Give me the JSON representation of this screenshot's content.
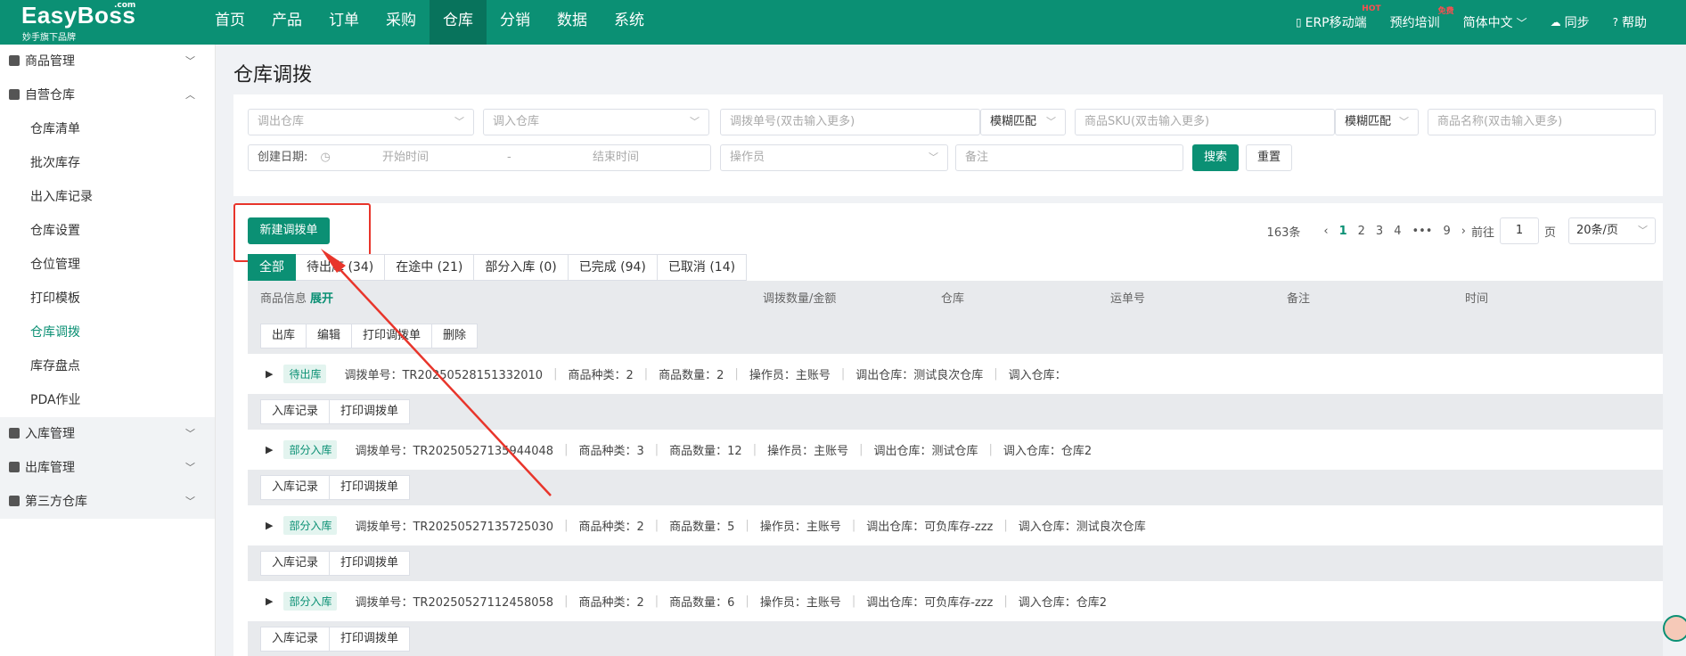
{
  "logo": {
    "brand": "EasyBoss",
    "com": ".com",
    "sub": "妙手旗下品牌"
  },
  "nav": [
    {
      "label": "首页"
    },
    {
      "label": "产品"
    },
    {
      "label": "订单"
    },
    {
      "label": "采购"
    },
    {
      "label": "仓库"
    },
    {
      "label": "分销"
    },
    {
      "label": "数据"
    },
    {
      "label": "系统"
    }
  ],
  "nav_active": "仓库",
  "right_nav": {
    "erp": "ERP移动端",
    "erp_sup": "HOT",
    "training": "预约培训",
    "training_sup": "免费",
    "lang": "简体中文",
    "sync": "同步",
    "help": "帮助"
  },
  "sidebar": {
    "groups": [
      {
        "label": "商品管理"
      },
      {
        "label": "自营仓库"
      },
      {
        "label": "入库管理"
      },
      {
        "label": "出库管理"
      },
      {
        "label": "第三方仓库"
      }
    ],
    "items": [
      {
        "label": "仓库清单"
      },
      {
        "label": "批次库存"
      },
      {
        "label": "出入库记录"
      },
      {
        "label": "仓库设置"
      },
      {
        "label": "仓位管理"
      },
      {
        "label": "打印模板"
      },
      {
        "label": "仓库调拨"
      },
      {
        "label": "库存盘点"
      },
      {
        "label": "PDA作业"
      }
    ]
  },
  "page": {
    "title": "仓库调拨"
  },
  "filters": {
    "out_wh": "调出仓库",
    "in_wh": "调入仓库",
    "order_no": "调拨单号(双击输入更多)",
    "match1": "模糊匹配",
    "sku": "商品SKU(双击输入更多)",
    "match2": "模糊匹配",
    "name": "商品名称(双击输入更多)",
    "date_label": "创建日期:",
    "start": "开始时间",
    "dash": "-",
    "end": "结束时间",
    "operator": "操作员",
    "remark": "备注",
    "search": "搜索",
    "reset": "重置"
  },
  "list": {
    "new_button": "新建调拨单",
    "pager": {
      "total": "163条",
      "prev": "‹",
      "pages": [
        "1",
        "2",
        "3",
        "4",
        "•••",
        "9"
      ],
      "current": "1",
      "next": "›",
      "goto": "前往",
      "goto_value": "1",
      "page_unit": "页",
      "page_size": "20条/页"
    },
    "tabs": [
      {
        "label": "全部"
      },
      {
        "label": "待出库 (34)"
      },
      {
        "label": "在途中 (21)"
      },
      {
        "label": "部分入库 (0)"
      },
      {
        "label": "已完成 (94)"
      },
      {
        "label": "已取消 (14)"
      }
    ],
    "columns": {
      "product": "商品信息",
      "expand": "展开",
      "qty": "调拨数量/金额",
      "warehouse": "仓库",
      "tracking": "运单号",
      "remark": "备注",
      "time": "时间"
    },
    "first_actions": [
      "出库",
      "编辑",
      "打印调拨单",
      "删除"
    ],
    "record_actions": [
      "入库记录",
      "打印调拨单"
    ],
    "rows": [
      {
        "status": "待出库",
        "no": "调拨单号：TR20250528151332010",
        "kinds": "商品种类：2",
        "qty": "商品数量：2",
        "op": "操作员：主账号",
        "out": "调出仓库：测试良次仓库",
        "in": "调入仓库："
      },
      {
        "status": "部分入库",
        "no": "调拨单号：TR20250527135944048",
        "kinds": "商品种类：3",
        "qty": "商品数量：12",
        "op": "操作员：主账号",
        "out": "调出仓库：测试仓库",
        "in": "调入仓库：仓库2"
      },
      {
        "status": "部分入库",
        "no": "调拨单号：TR20250527135725030",
        "kinds": "商品种类：2",
        "qty": "商品数量：5",
        "op": "操作员：主账号",
        "out": "调出仓库：可负库存-zzz",
        "in": "调入仓库：测试良次仓库"
      },
      {
        "status": "部分入库",
        "no": "调拨单号：TR20250527112458058",
        "kinds": "商品种类：2",
        "qty": "商品数量：6",
        "op": "操作员：主账号",
        "out": "调出仓库：可负库存-zzz",
        "in": "调入仓库：仓库2"
      }
    ]
  },
  "colors": {
    "brand": "#0b9074",
    "annotation": "#e8352b"
  }
}
